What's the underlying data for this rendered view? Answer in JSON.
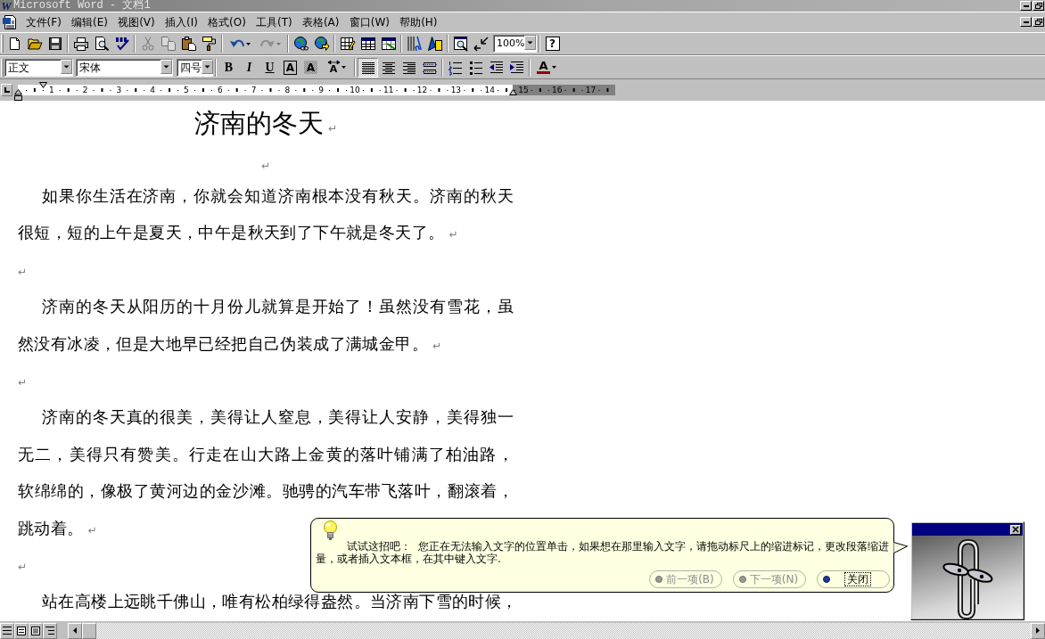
{
  "window": {
    "logo": "W",
    "title": "Microsoft Word - 文档1"
  },
  "menu_bar": {
    "items": [
      {
        "label": "文件(F)"
      },
      {
        "label": "编辑(E)"
      },
      {
        "label": "视图(V)"
      },
      {
        "label": "插入(I)"
      },
      {
        "label": "格式(O)"
      },
      {
        "label": "工具(T)"
      },
      {
        "label": "表格(A)"
      },
      {
        "label": "窗口(W)"
      },
      {
        "label": "帮助(H)"
      }
    ]
  },
  "standard_toolbar": {
    "buttons": [
      {
        "disabled": false
      },
      {
        "disabled": false
      },
      {
        "disabled": false
      },
      {
        "disabled": false
      },
      {
        "disabled": false
      },
      {
        "disabled": false
      },
      {
        "disabled": true
      },
      {
        "disabled": true
      },
      {
        "disabled": false
      },
      {
        "disabled": false
      },
      {
        "disabled": false
      },
      {
        "disabled": true
      },
      {
        "disabled": false
      },
      {
        "disabled": false
      },
      {
        "disabled": false
      },
      {
        "disabled": false
      },
      {
        "disabled": false
      },
      {
        "disabled": false
      },
      {
        "disabled": false
      },
      {
        "disabled": false
      },
      {
        "disabled": false
      }
    ],
    "zoom": "100%",
    "help": "?"
  },
  "formatting_toolbar": {
    "style": "正文",
    "font": "宋体",
    "size": "四号",
    "letters": [
      {
        "kind": "bold",
        "label": "B"
      },
      {
        "kind": "italic",
        "label": "I"
      },
      {
        "kind": "underline",
        "label": "U"
      },
      {
        "kind": "border",
        "label": "A"
      },
      {
        "kind": "shading",
        "label": "A"
      },
      {
        "kind": "scale",
        "label": "A"
      }
    ],
    "alignment": [
      {
        "selected": true
      },
      {
        "selected": false
      },
      {
        "selected": false
      },
      {
        "selected": false
      }
    ],
    "font_color": "A"
  },
  "ruler": {
    "labels": [
      "1",
      "2",
      "3",
      "4",
      "5",
      "6",
      "7",
      "8",
      "9",
      "10",
      "11",
      "12",
      "13",
      "14",
      "15",
      "16",
      "17"
    ]
  },
  "document": {
    "paragraphs": [
      {
        "kind": "title",
        "lines": [
          "济南的冬天"
        ],
        "mark": "↵"
      },
      {
        "kind": "centered",
        "mark": "↵"
      },
      {
        "kind": "body",
        "lines": [
          "如果你生活在济南，你就会知道济南根本没有秋天。济南的秋天",
          "很短，短的上午是夏天，中午是秋天到了下午就是冬天了。"
        ],
        "mark": "↵"
      },
      {
        "kind": "blank",
        "mark": "↵"
      },
      {
        "kind": "body",
        "lines": [
          "济南的冬天从阳历的十月份儿就算是开始了！虽然没有雪花，虽",
          "然没有冰凌，但是大地早已经把自己伪装成了满城金甲。"
        ],
        "mark": "↵"
      },
      {
        "kind": "blank",
        "mark": "↵"
      },
      {
        "kind": "body",
        "lines": [
          "济南的冬天真的很美，美得让人窒息，美得让人安静，美得独一",
          "无二，美得只有赞美。行走在山大路上金黄的落叶铺满了柏油路，",
          "软绵绵的，像极了黄河边的金沙滩。驰骋的汽车带飞落叶，翻滚着，",
          "跳动着。"
        ],
        "mark": "↵"
      },
      {
        "kind": "blank",
        "mark": "↵"
      },
      {
        "kind": "body",
        "lines": [
          "站在高楼上远眺千佛山，唯有松柏绿得盎然。当济南下雪的时候，"
        ]
      }
    ]
  },
  "tip_balloon": {
    "text": "试试这招吧：  您正在无法输入文字的位置单击，如果想在那里输入文字，请拖动标尺上的缩进标记，更改段落缩进量，或者插入文本框，在其中键入文字.",
    "buttons": [
      {
        "label": "前一项(B)",
        "disabled": true,
        "focused": false
      },
      {
        "label": "下一项(N)",
        "disabled": true,
        "focused": false
      },
      {
        "label": "关闭",
        "disabled": false,
        "focused": true
      }
    ]
  },
  "office_assistant": {
    "visible": true
  }
}
